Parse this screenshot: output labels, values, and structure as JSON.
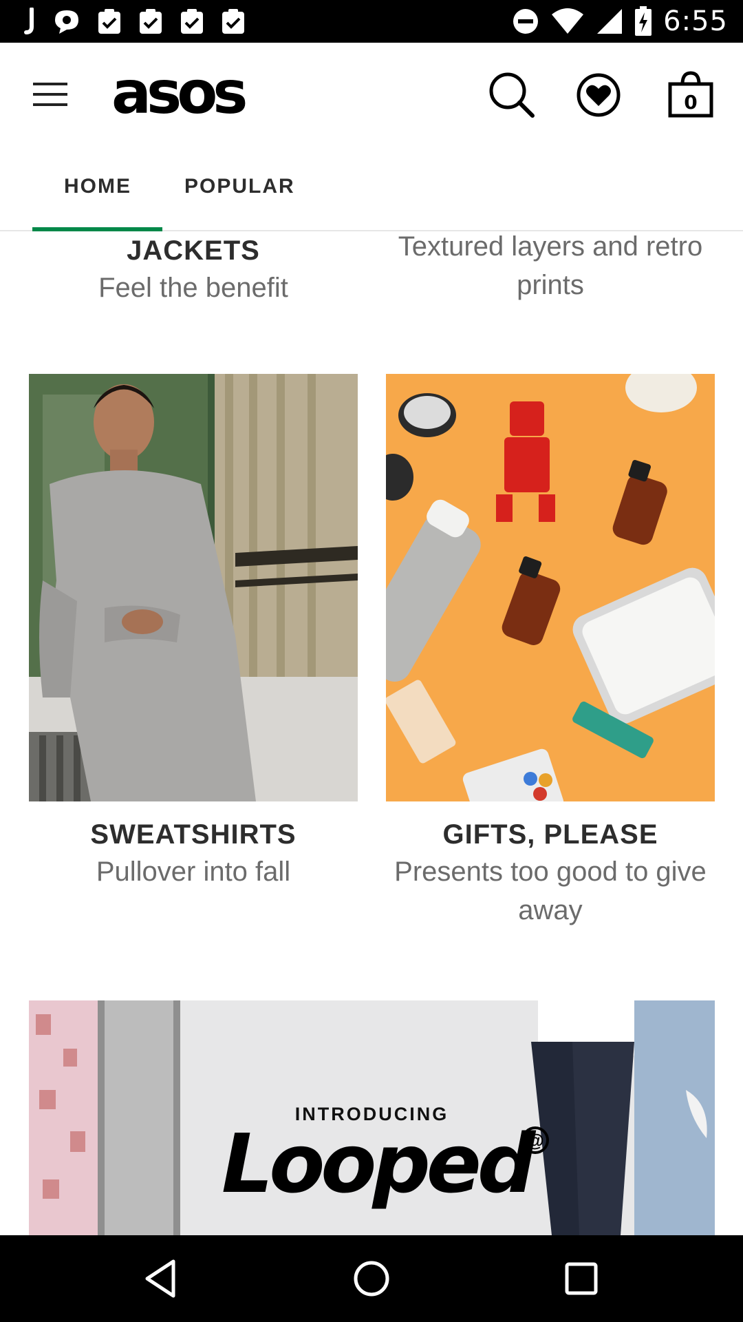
{
  "status_bar": {
    "time": "6:55",
    "left_icons": [
      "j-app-icon",
      "chat-icon",
      "clipboard-check-icon",
      "clipboard-check-icon",
      "clipboard-check-icon",
      "clipboard-check-icon"
    ],
    "right_icons": [
      "do-not-disturb-icon",
      "wifi-icon",
      "signal-icon",
      "battery-charging-icon"
    ]
  },
  "header": {
    "logo": "asos",
    "bag_count": "0",
    "icons": [
      "menu-icon",
      "search-icon",
      "heart-icon",
      "bag-icon"
    ]
  },
  "tabs": [
    {
      "label": "HOME",
      "active": true
    },
    {
      "label": "POPULAR",
      "active": false
    }
  ],
  "colors": {
    "accent": "#018849",
    "text": "#2d2d2d",
    "subtext": "#6b6b6b",
    "gift_background": "#f7a84a"
  },
  "content": {
    "top_left": {
      "title": "JACKETS",
      "subtitle": "Feel the benefit"
    },
    "top_right": {
      "subtitle_line1": "Textured layers and retro",
      "subtitle_line2": "prints"
    },
    "left_card": {
      "title": "SWEATSHIRTS",
      "subtitle": "Pullover into fall"
    },
    "right_card": {
      "title": "GIFTS, PLEASE",
      "subtitle_line1": "Presents too good to give",
      "subtitle_line2": "away"
    },
    "banner": {
      "intro": "INTRODUCING",
      "brand": "Looped",
      "mark": "@"
    }
  },
  "nav_bar": {
    "icons": [
      "back-icon",
      "home-icon",
      "recents-icon"
    ]
  }
}
